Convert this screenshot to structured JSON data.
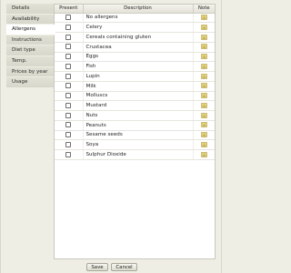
{
  "tabs": [
    {
      "label": "Details",
      "active": false
    },
    {
      "label": "Availability",
      "active": false
    },
    {
      "label": "Allergens",
      "active": true
    },
    {
      "label": "Instructions",
      "active": false
    },
    {
      "label": "Diet type",
      "active": false
    },
    {
      "label": "Temp.",
      "active": false
    },
    {
      "label": "Prices by year",
      "active": false
    },
    {
      "label": "Usage",
      "active": false
    }
  ],
  "table": {
    "headers": {
      "present": "Present",
      "description": "Description",
      "note": "Note"
    },
    "rows": [
      {
        "description": "No allergens",
        "checked": false
      },
      {
        "description": "Celery",
        "checked": false
      },
      {
        "description": "Cereals containing gluten",
        "checked": false
      },
      {
        "description": "Crustacea",
        "checked": false
      },
      {
        "description": "Eggs",
        "checked": false
      },
      {
        "description": "Fish",
        "checked": false
      },
      {
        "description": "Lupin",
        "checked": false
      },
      {
        "description": "Milk",
        "checked": false
      },
      {
        "description": "Molluscs",
        "checked": false
      },
      {
        "description": "Mustard",
        "checked": false
      },
      {
        "description": "Nuts",
        "checked": false
      },
      {
        "description": "Peanuts",
        "checked": false
      },
      {
        "description": "Sesame seeds",
        "checked": false
      },
      {
        "description": "Soya",
        "checked": false
      },
      {
        "description": "Sulphur Dioxide",
        "checked": false
      }
    ],
    "note_icon": "note-icon"
  },
  "footer": {
    "save_label": "Save",
    "cancel_label": "Cancel"
  },
  "colors": {
    "background": "#efeee4",
    "panel": "#ffffff",
    "note_icon": "#d8c25a"
  }
}
